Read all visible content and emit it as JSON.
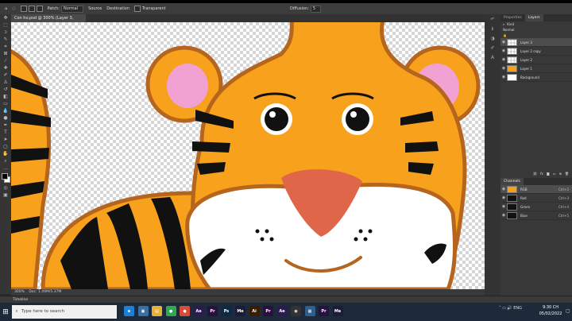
{
  "options_bar": {
    "patch_label": "Patch:",
    "patch_mode": "Normal",
    "source_label": "Source",
    "destination_label": "Destination",
    "transparent_label": "Transparent",
    "diffusion_label": "Diffusion:",
    "diffusion_value": "5"
  },
  "document": {
    "tab_title": "Con ho.psd @ 300% (Layer 3, RGB/8#) *",
    "zoom": "300%",
    "doc_info": "Doc: 1.49M/5.37M"
  },
  "timeline": {
    "label": "Timeline"
  },
  "layers_panel": {
    "tabs": [
      "Properties",
      "Layers"
    ],
    "active_tab": "Layers",
    "kind_filter": "Kind",
    "mode": "Normal",
    "layers": [
      {
        "name": "Layer 3",
        "selected": true,
        "thumb": "transparent"
      },
      {
        "name": "Layer 2 copy",
        "selected": false,
        "thumb": "transparent"
      },
      {
        "name": "Layer 2",
        "selected": false,
        "thumb": "transparent"
      },
      {
        "name": "Layer 1",
        "selected": false,
        "thumb": "tiger"
      },
      {
        "name": "Background",
        "selected": false,
        "thumb": "white"
      }
    ]
  },
  "channels_panel": {
    "tab": "Channels",
    "channels": [
      {
        "name": "RGB",
        "shortcut": "Ctrl+2"
      },
      {
        "name": "Red",
        "shortcut": "Ctrl+3"
      },
      {
        "name": "Green",
        "shortcut": "Ctrl+4"
      },
      {
        "name": "Blue",
        "shortcut": "Ctrl+5"
      }
    ]
  },
  "taskbar": {
    "search_placeholder": "Type here to search",
    "apps": [
      {
        "icon": "edge-icon",
        "label": "e",
        "color": "#1e7fd6"
      },
      {
        "icon": "store-icon",
        "label": "▣",
        "color": "#3a6ea5"
      },
      {
        "icon": "explorer-icon",
        "label": "▤",
        "color": "#e8b23a"
      },
      {
        "icon": "chrome-icon",
        "label": "●",
        "color": "#2da94f"
      },
      {
        "icon": "chrome-alt-icon",
        "label": "●",
        "color": "#d64b3a"
      },
      {
        "icon": "after-effects-icon",
        "label": "Ae",
        "color": "#2b1b52"
      },
      {
        "icon": "premiere-icon",
        "label": "Pr",
        "color": "#2a0f3f"
      },
      {
        "icon": "photoshop-icon",
        "label": "Ps",
        "color": "#0a2a45"
      },
      {
        "icon": "media-encoder-icon",
        "label": "Me",
        "color": "#1c1c3a"
      },
      {
        "icon": "illustrator-icon",
        "label": "Ai",
        "color": "#3a1c00"
      },
      {
        "icon": "premiere-alt-icon",
        "label": "Pr",
        "color": "#2a0f3f"
      },
      {
        "icon": "after-effects-alt-icon",
        "label": "Ae",
        "color": "#2b1b52"
      },
      {
        "icon": "record-icon",
        "label": "◉",
        "color": "#333333"
      },
      {
        "icon": "photos-icon",
        "label": "▦",
        "color": "#2f5f8f"
      },
      {
        "icon": "premiere-alt2-icon",
        "label": "Pr",
        "color": "#2a0f3f"
      },
      {
        "icon": "media-encoder-alt-icon",
        "label": "Me",
        "color": "#1c1c3a"
      }
    ],
    "lang": "ENG",
    "time": "9:30 CH",
    "date": "05/02/2022"
  },
  "colors": {
    "tiger_orange": "#F7A11D",
    "outline_brown": "#B5651D",
    "ear_pink": "#F2A2D2",
    "nose": "#E0664A"
  }
}
